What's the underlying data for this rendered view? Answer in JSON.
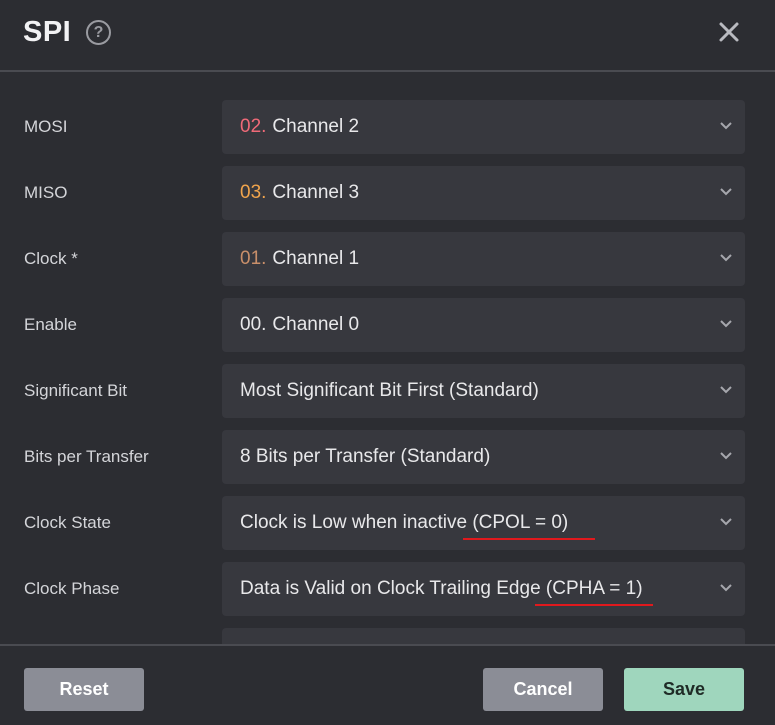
{
  "dialog": {
    "title": "SPI",
    "help_icon": "question-circle-icon",
    "close_icon": "close-icon"
  },
  "fields": [
    {
      "label": "MOSI",
      "channel_num": "02.",
      "channel_color": "#f06a78",
      "value": "Channel 2"
    },
    {
      "label": "MISO",
      "channel_num": "03.",
      "channel_color": "#f0a44c",
      "value": "Channel 3"
    },
    {
      "label": "Clock *",
      "channel_num": "01.",
      "channel_color": "#c98f6a",
      "value": "Channel 1"
    },
    {
      "label": "Enable",
      "channel_num": "00.",
      "channel_color": "#e8e8ea",
      "value": "Channel 0"
    },
    {
      "label": "Significant Bit",
      "value": "Most Significant Bit First (Standard)"
    },
    {
      "label": "Bits per Transfer",
      "value": "8 Bits per Transfer (Standard)"
    },
    {
      "label": "Clock State",
      "value": "Clock is Low when inactive (CPOL = 0)"
    },
    {
      "label": "Clock Phase",
      "value": "Data is Valid on Clock Trailing Edge (CPHA = 1)"
    }
  ],
  "buttons": {
    "reset": "Reset",
    "cancel": "Cancel",
    "save": "Save"
  },
  "colors": {
    "annotation_underline": "#e0191d",
    "save_button": "#9fd6bd",
    "neutral_button": "#8b8d96"
  }
}
